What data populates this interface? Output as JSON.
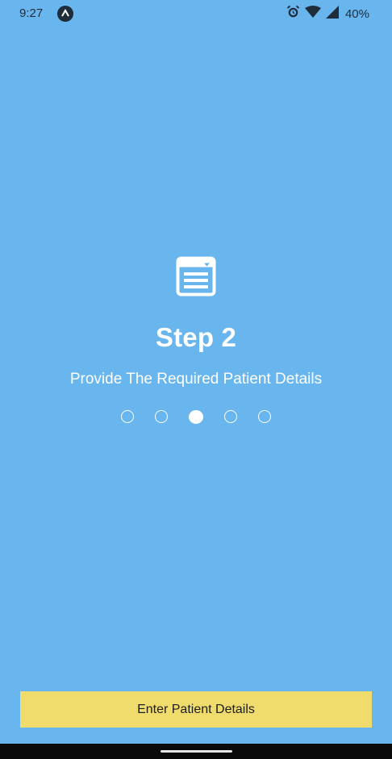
{
  "status_bar": {
    "time": "9:27",
    "battery": "40%",
    "icons": [
      "app-notification-icon",
      "alarm-icon",
      "wifi-icon",
      "signal-icon"
    ]
  },
  "step": {
    "icon": "form-document-icon",
    "title": "Step 2",
    "subtitle": "Provide The Required Patient Details",
    "total_steps": 5,
    "current_index": 2
  },
  "primary_button": {
    "label": "Enter Patient Details"
  },
  "colors": {
    "background": "#69B5EE",
    "button": "#F0DC6C",
    "text": "#FFFFFF"
  }
}
